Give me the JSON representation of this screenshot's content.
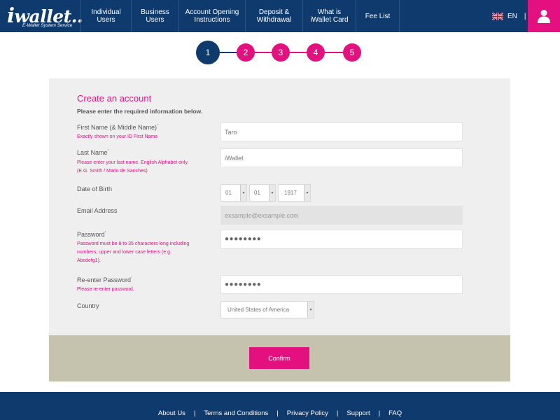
{
  "header": {
    "logo_text": "wallet",
    "logo_i": "i",
    "logo_dots": "..",
    "logo_tagline": "E-Wallet System Service",
    "nav": [
      {
        "line1": "Individual",
        "line2": "Users"
      },
      {
        "line1": "Business",
        "line2": "Users"
      },
      {
        "line1": "Account Opening",
        "line2": "Instructions"
      },
      {
        "line1": "Deposit &",
        "line2": "Withdrawal"
      },
      {
        "line1": "What is",
        "line2": "iWallet Card"
      },
      {
        "line1": "Fee List",
        "line2": ""
      }
    ],
    "language": "EN",
    "language_separator": "|"
  },
  "stepper": {
    "steps": [
      "1",
      "2",
      "3",
      "4",
      "5"
    ],
    "active_step": 1
  },
  "form": {
    "title": "Create an account",
    "subtitle": "Please enter the required information below.",
    "required_mark": "*",
    "first_name": {
      "label": "First Name (& Middle Name)",
      "hint": "Exactly shown on your ID First Name",
      "value": "Taro"
    },
    "last_name": {
      "label": "Last Name",
      "hint_line1": "Please enter your last name. English Alphabet only.",
      "hint_line2": "(E.G. Smith / Mario de Sanches)",
      "value": "iWallet"
    },
    "dob": {
      "label": "Date of Birth",
      "month": "01",
      "day": "01",
      "year": "1917"
    },
    "email": {
      "label": "Email Address",
      "value": "exsample@exsample.com"
    },
    "password": {
      "label": "Password",
      "hint_line1": "Password must be 8 to 35 characters long including",
      "hint_line2": "numbers, upper and lower case letters (e.g.",
      "hint_line3": "Abcdefg1).",
      "masked": "●●●●●●●●"
    },
    "reenter_password": {
      "label": "Re-enter Password",
      "hint": "Please re-enter password.",
      "masked": "●●●●●●●●"
    },
    "country": {
      "label": "Country",
      "value": "United States of America"
    },
    "confirm_label": "Confirm"
  },
  "footer": {
    "links": [
      "About Us",
      "Terms and Conditions",
      "Privacy Policy",
      "Support",
      "FAQ"
    ],
    "separator": "|"
  },
  "colors": {
    "navy": "#0e3a6e",
    "pink": "#e4107f",
    "card_bg": "#efefef",
    "band_bg": "#c5c2ad"
  }
}
